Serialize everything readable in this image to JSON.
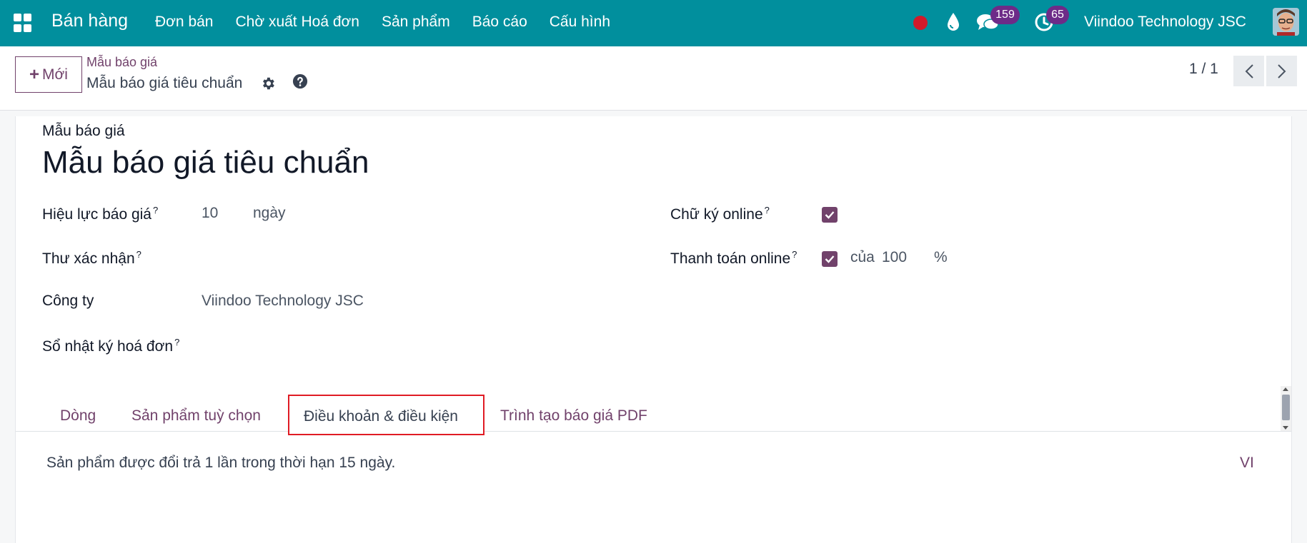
{
  "navbar": {
    "app_name": "Bán hàng",
    "menu": [
      "Đơn bán",
      "Chờ xuất Hoá đơn",
      "Sản phẩm",
      "Báo cáo",
      "Cấu hình"
    ],
    "messages_count": "159",
    "activities_count": "65",
    "company": "Viindoo Technology JSC",
    "color": "#018f9d"
  },
  "control_panel": {
    "new_button": "Mới",
    "breadcrumb_parent": "Mẫu báo giá",
    "breadcrumb_current": "Mẫu báo giá tiêu chuẩn",
    "pager": "1 / 1"
  },
  "form": {
    "subtitle": "Mẫu báo giá",
    "title": "Mẫu báo giá tiêu chuẩn",
    "fields": {
      "validity_label": "Hiệu lực báo giá",
      "validity_value": "10",
      "validity_unit": "ngày",
      "confirmation_mail_label": "Thư xác nhận",
      "company_label": "Công ty",
      "company_value": "Viindoo Technology JSC",
      "invoice_journal_label": "Sổ nhật ký hoá đơn",
      "online_signature_label": "Chữ ký online",
      "online_signature_checked": true,
      "online_payment_label": "Thanh toán online",
      "online_payment_checked": true,
      "payment_prefix": "của",
      "payment_value": "100",
      "payment_unit": "%"
    },
    "help_mark": "?",
    "tabs": [
      "Dòng",
      "Sản phẩm tuỳ chọn",
      "Điều khoản & điều kiện",
      "Trình tạo báo giá PDF"
    ],
    "active_tab": "Điều khoản & điều kiện",
    "terms_text": "Sản phẩm được đổi trả 1 lần trong thời hạn 15 ngày.",
    "language_code": "VI",
    "accent_color": "#71426b"
  }
}
